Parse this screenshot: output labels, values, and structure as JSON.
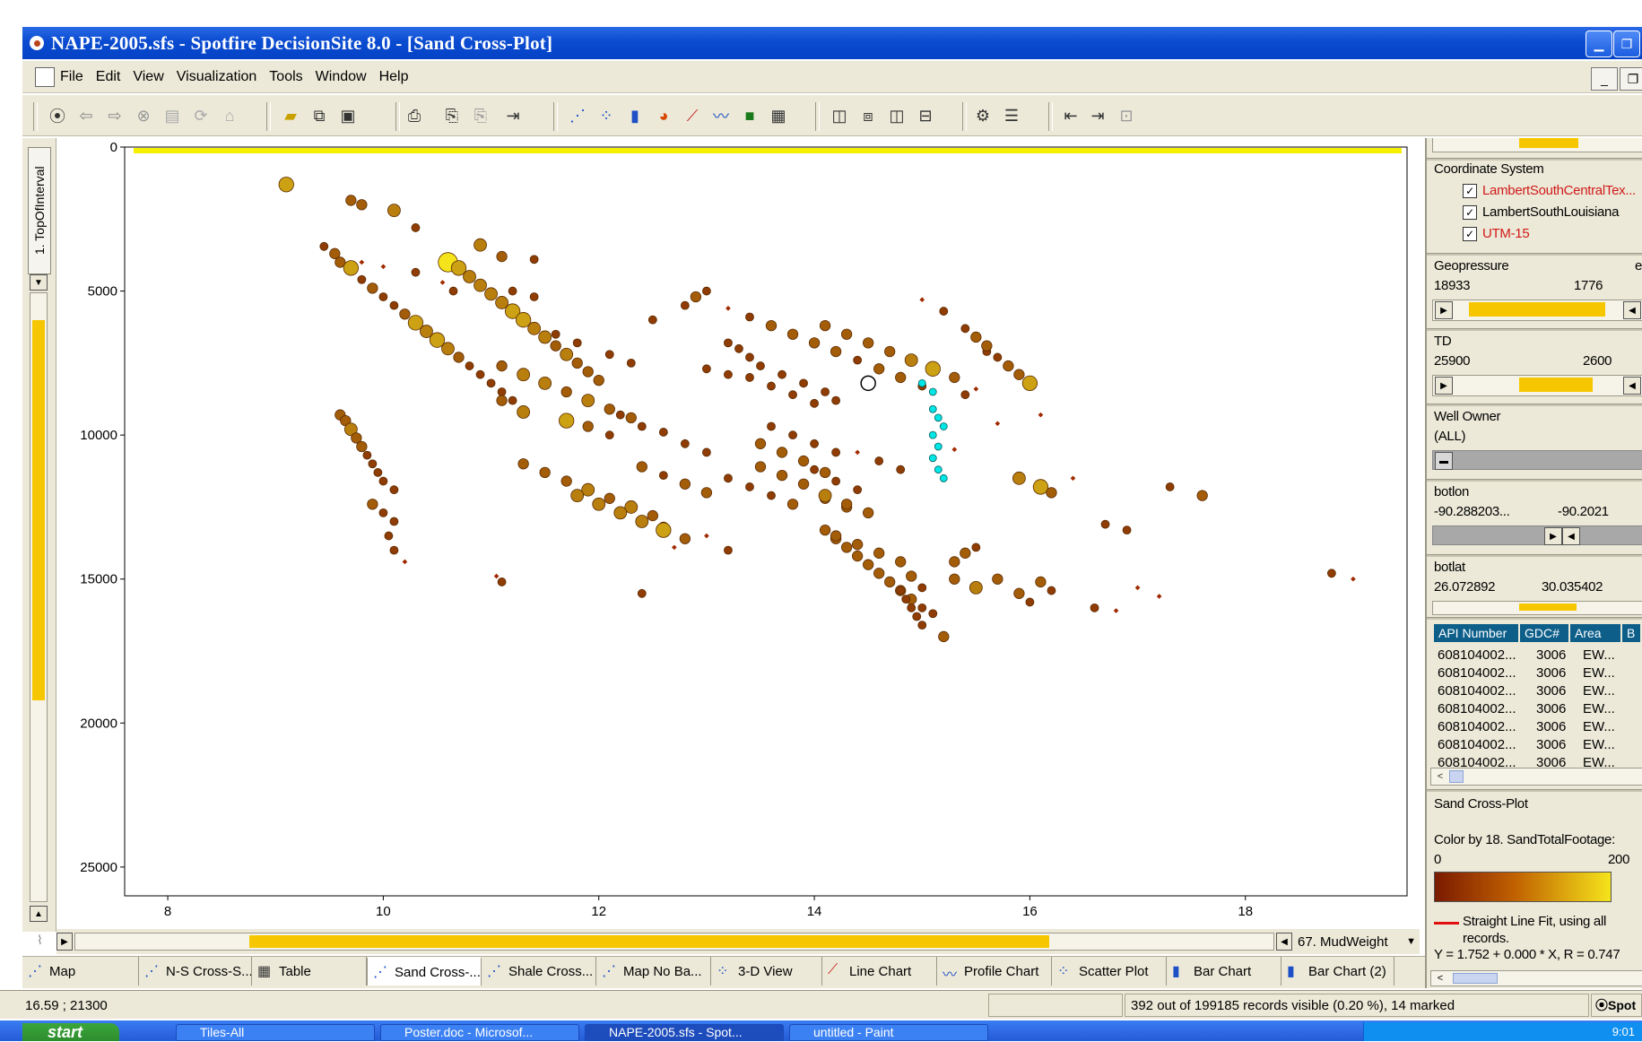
{
  "window": {
    "title": "NAPE-2005.sfs - Spotfire DecisionSite 8.0 - [Sand Cross-Plot]"
  },
  "menu": [
    "File",
    "Edit",
    "View",
    "Visualization",
    "Tools",
    "Window",
    "Help"
  ],
  "toolbar_icons": [
    "home-icon",
    "back-icon",
    "forward-icon",
    "stop-icon",
    "doc-icon",
    "refresh-icon",
    "house-icon",
    "open-icon",
    "copy-icon",
    "save-icon",
    "print-icon",
    "paste-icon",
    "paste2-icon",
    "export-icon",
    "scatter-icon",
    "scatter3d-icon",
    "bar-icon",
    "pie-icon",
    "line-icon",
    "profile-icon",
    "heatmap-icon",
    "table-icon",
    "layout1-icon",
    "layout2-icon",
    "layout3-icon",
    "layout4-icon",
    "properties-icon",
    "legend-icon",
    "prev-icon",
    "next-icon",
    "zoom-icon"
  ],
  "left_axis_label": "1. TopOfInterval",
  "x_axis_selector": "67. MudWeight",
  "chart_data": {
    "type": "scatter",
    "title": "",
    "xlabel": "",
    "ylabel": "",
    "xlim": [
      7.6,
      19.5
    ],
    "ylim": [
      0,
      26000
    ],
    "y_inverted": true,
    "x_ticks": [
      8,
      10,
      12,
      14,
      16,
      18
    ],
    "y_ticks": [
      0,
      5000,
      10000,
      15000,
      20000,
      25000
    ],
    "y_tick_labels": [
      "0",
      "5000",
      "10000",
      "15000",
      "20000",
      "25000"
    ],
    "color_scale": {
      "min": 0,
      "max": 200,
      "low_color": "#7a1a00",
      "high_color": "#f5e41c"
    },
    "reference_line": {
      "y": 0,
      "color": "#f7ef00"
    },
    "highlight_color": "#00e5e5",
    "points": [
      [
        9.1,
        1300,
        5
      ],
      [
        9.7,
        1850,
        3
      ],
      [
        9.8,
        2000,
        3
      ],
      [
        10.1,
        2200,
        4
      ],
      [
        10.3,
        2800,
        2
      ],
      [
        10.9,
        3400,
        4
      ],
      [
        11.1,
        3800,
        3
      ],
      [
        11.4,
        3900,
        2
      ],
      [
        9.45,
        3450,
        2
      ],
      [
        9.55,
        3700,
        3
      ],
      [
        9.6,
        4000,
        3
      ],
      [
        9.7,
        4200,
        5
      ],
      [
        9.8,
        4600,
        2
      ],
      [
        9.9,
        4900,
        3
      ],
      [
        10.0,
        5200,
        2
      ],
      [
        10.1,
        5500,
        2
      ],
      [
        10.2,
        5800,
        3
      ],
      [
        10.3,
        6100,
        5
      ],
      [
        10.4,
        6400,
        4
      ],
      [
        10.5,
        6700,
        5
      ],
      [
        10.6,
        7000,
        4
      ],
      [
        10.7,
        7300,
        3
      ],
      [
        10.8,
        7600,
        2
      ],
      [
        10.9,
        7900,
        2
      ],
      [
        11.0,
        8200,
        2
      ],
      [
        11.1,
        8500,
        2
      ],
      [
        11.2,
        8800,
        2
      ],
      [
        9.8,
        4000,
        1
      ],
      [
        10.0,
        4150,
        1
      ],
      [
        10.3,
        4350,
        2
      ],
      [
        10.55,
        4700,
        1
      ],
      [
        10.65,
        5000,
        2
      ],
      [
        10.6,
        4000,
        7
      ],
      [
        10.7,
        4200,
        5
      ],
      [
        10.8,
        4500,
        4
      ],
      [
        10.9,
        4800,
        4
      ],
      [
        11.0,
        5100,
        4
      ],
      [
        11.1,
        5400,
        4
      ],
      [
        11.2,
        5700,
        5
      ],
      [
        11.3,
        6000,
        5
      ],
      [
        11.4,
        6300,
        4
      ],
      [
        11.5,
        6600,
        4
      ],
      [
        11.6,
        6900,
        3
      ],
      [
        11.7,
        7200,
        4
      ],
      [
        11.8,
        7500,
        3
      ],
      [
        11.9,
        7800,
        3
      ],
      [
        12.0,
        8100,
        3
      ],
      [
        11.1,
        7600,
        3
      ],
      [
        11.3,
        7900,
        4
      ],
      [
        11.5,
        8200,
        4
      ],
      [
        11.7,
        8500,
        3
      ],
      [
        11.9,
        8800,
        4
      ],
      [
        12.1,
        9100,
        3
      ],
      [
        12.3,
        9400,
        3
      ],
      [
        11.2,
        5000,
        2
      ],
      [
        11.4,
        5200,
        2
      ],
      [
        11.6,
        6500,
        2
      ],
      [
        11.8,
        6800,
        2
      ],
      [
        12.1,
        7200,
        2
      ],
      [
        12.3,
        7500,
        2
      ],
      [
        11.1,
        8800,
        3
      ],
      [
        11.3,
        9200,
        4
      ],
      [
        11.7,
        9500,
        5
      ],
      [
        11.9,
        9700,
        3
      ],
      [
        12.1,
        10000,
        2
      ],
      [
        11.3,
        11000,
        3
      ],
      [
        11.5,
        11300,
        3
      ],
      [
        11.7,
        11600,
        3
      ],
      [
        11.9,
        11900,
        4
      ],
      [
        12.1,
        12200,
        3
      ],
      [
        12.3,
        12500,
        4
      ],
      [
        12.5,
        12800,
        3
      ],
      [
        12.6,
        13200,
        3
      ],
      [
        11.8,
        12100,
        4
      ],
      [
        12.0,
        12400,
        4
      ],
      [
        12.2,
        12700,
        4
      ],
      [
        12.4,
        13000,
        4
      ],
      [
        12.6,
        13300,
        5
      ],
      [
        12.8,
        13600,
        3
      ],
      [
        12.2,
        9300,
        2
      ],
      [
        12.4,
        9700,
        2
      ],
      [
        12.6,
        9900,
        2
      ],
      [
        12.8,
        10300,
        2
      ],
      [
        13.0,
        10600,
        2
      ],
      [
        12.4,
        11100,
        3
      ],
      [
        12.6,
        11400,
        2
      ],
      [
        12.8,
        11700,
        3
      ],
      [
        13.0,
        12000,
        3
      ],
      [
        9.6,
        9300,
        3
      ],
      [
        9.65,
        9500,
        3
      ],
      [
        9.7,
        9800,
        4
      ],
      [
        9.75,
        10100,
        3
      ],
      [
        9.8,
        10400,
        3
      ],
      [
        9.85,
        10700,
        2
      ],
      [
        9.9,
        11000,
        2
      ],
      [
        9.95,
        11300,
        2
      ],
      [
        10.0,
        11600,
        2
      ],
      [
        10.1,
        11900,
        2
      ],
      [
        9.9,
        12400,
        3
      ],
      [
        10.0,
        12700,
        2
      ],
      [
        10.1,
        13000,
        2
      ],
      [
        10.05,
        13500,
        2
      ],
      [
        10.1,
        14000,
        2
      ],
      [
        10.2,
        14400,
        1
      ],
      [
        11.05,
        14900,
        1
      ],
      [
        11.1,
        15100,
        2
      ],
      [
        12.4,
        15500,
        2
      ],
      [
        13.2,
        14000,
        2
      ],
      [
        12.7,
        13900,
        1
      ],
      [
        13.0,
        13500,
        1
      ],
      [
        12.5,
        6000,
        2
      ],
      [
        12.8,
        5500,
        2
      ],
      [
        12.9,
        5200,
        3
      ],
      [
        13.0,
        5000,
        2
      ],
      [
        13.2,
        6800,
        2
      ],
      [
        13.3,
        7000,
        2
      ],
      [
        13.4,
        7300,
        2
      ],
      [
        13.5,
        7600,
        2
      ],
      [
        13.7,
        7900,
        2
      ],
      [
        13.9,
        8200,
        2
      ],
      [
        14.1,
        8500,
        2
      ],
      [
        14.2,
        8800,
        2
      ],
      [
        13.0,
        7700,
        2
      ],
      [
        13.2,
        7900,
        2
      ],
      [
        13.4,
        8000,
        2
      ],
      [
        13.6,
        8300,
        2
      ],
      [
        13.8,
        8600,
        2
      ],
      [
        14.0,
        8900,
        2
      ],
      [
        13.2,
        5600,
        1
      ],
      [
        13.4,
        5900,
        2
      ],
      [
        13.6,
        6200,
        3
      ],
      [
        13.8,
        6500,
        3
      ],
      [
        14.0,
        6800,
        3
      ],
      [
        14.2,
        7100,
        3
      ],
      [
        14.4,
        7400,
        2
      ],
      [
        14.6,
        7700,
        3
      ],
      [
        14.8,
        8000,
        3
      ],
      [
        15.0,
        8300,
        2
      ],
      [
        14.1,
        6200,
        3
      ],
      [
        14.3,
        6500,
        3
      ],
      [
        14.5,
        6800,
        3
      ],
      [
        14.7,
        7100,
        3
      ],
      [
        14.9,
        7400,
        4
      ],
      [
        15.1,
        7700,
        5
      ],
      [
        15.3,
        8000,
        3
      ],
      [
        13.6,
        9700,
        2
      ],
      [
        13.8,
        10000,
        2
      ],
      [
        14.0,
        10300,
        2
      ],
      [
        14.2,
        10600,
        2
      ],
      [
        14.0,
        11200,
        2
      ],
      [
        14.2,
        11600,
        2
      ],
      [
        14.4,
        11900,
        2
      ],
      [
        14.1,
        12200,
        3
      ],
      [
        14.3,
        12500,
        3
      ],
      [
        13.5,
        10300,
        3
      ],
      [
        13.7,
        10600,
        3
      ],
      [
        13.9,
        10900,
        3
      ],
      [
        14.1,
        11300,
        3
      ],
      [
        13.2,
        11500,
        2
      ],
      [
        13.4,
        11800,
        2
      ],
      [
        13.6,
        12100,
        2
      ],
      [
        13.8,
        12400,
        3
      ],
      [
        13.5,
        11100,
        3
      ],
      [
        13.7,
        11400,
        3
      ],
      [
        13.9,
        11700,
        3
      ],
      [
        14.1,
        12100,
        4
      ],
      [
        14.3,
        12400,
        3
      ],
      [
        14.5,
        12700,
        3
      ],
      [
        14.1,
        13300,
        3
      ],
      [
        14.2,
        13600,
        3
      ],
      [
        14.3,
        13900,
        3
      ],
      [
        14.4,
        14200,
        3
      ],
      [
        14.5,
        14500,
        3
      ],
      [
        14.6,
        14800,
        3
      ],
      [
        14.7,
        15100,
        3
      ],
      [
        14.8,
        15400,
        3
      ],
      [
        14.9,
        15700,
        3
      ],
      [
        15.0,
        16000,
        2
      ],
      [
        14.2,
        13500,
        3
      ],
      [
        14.4,
        13800,
        3
      ],
      [
        14.6,
        14100,
        3
      ],
      [
        14.8,
        14400,
        3
      ],
      [
        14.9,
        14900,
        3
      ],
      [
        15.0,
        15300,
        2
      ],
      [
        15.1,
        16200,
        2
      ],
      [
        15.2,
        17000,
        3
      ],
      [
        14.8,
        15400,
        2
      ],
      [
        14.85,
        15700,
        2
      ],
      [
        14.9,
        16000,
        2
      ],
      [
        14.95,
        16300,
        2
      ],
      [
        15.0,
        16600,
        2
      ],
      [
        15.3,
        14400,
        3
      ],
      [
        15.4,
        14100,
        3
      ],
      [
        15.5,
        13900,
        2
      ],
      [
        15.3,
        15000,
        3
      ],
      [
        15.5,
        15300,
        4
      ],
      [
        15.7,
        15000,
        3
      ],
      [
        15.9,
        15500,
        3
      ],
      [
        16.0,
        15800,
        2
      ],
      [
        16.1,
        15100,
        3
      ],
      [
        16.2,
        15400,
        2
      ],
      [
        15.6,
        7100,
        2
      ],
      [
        15.7,
        7300,
        2
      ],
      [
        15.8,
        7600,
        3
      ],
      [
        15.9,
        7900,
        3
      ],
      [
        16.0,
        8200,
        5
      ],
      [
        15.5,
        8400,
        1
      ],
      [
        16.1,
        9300,
        1
      ],
      [
        16.4,
        11500,
        1
      ],
      [
        15.9,
        11500,
        4
      ],
      [
        16.1,
        11800,
        5
      ],
      [
        16.2,
        12000,
        3
      ],
      [
        16.7,
        13100,
        2
      ],
      [
        16.9,
        13300,
        2
      ],
      [
        16.6,
        16000,
        2
      ],
      [
        14.4,
        10600,
        1
      ],
      [
        14.6,
        10900,
        2
      ],
      [
        14.8,
        11200,
        2
      ],
      [
        15.3,
        10500,
        1
      ],
      [
        15.0,
        5300,
        1
      ],
      [
        15.2,
        5700,
        2
      ],
      [
        15.4,
        6300,
        2
      ],
      [
        15.5,
        6600,
        3
      ],
      [
        15.6,
        6900,
        3
      ],
      [
        15.4,
        8600,
        2
      ],
      [
        15.7,
        9600,
        1
      ],
      [
        17.3,
        11800,
        2
      ],
      [
        17.6,
        12100,
        3
      ],
      [
        17.0,
        15300,
        1
      ],
      [
        17.2,
        15600,
        1
      ],
      [
        16.8,
        16100,
        1
      ],
      [
        18.8,
        14800,
        2
      ],
      [
        19.0,
        15000,
        1
      ]
    ],
    "highlighted_points": [
      [
        15.0,
        8200
      ],
      [
        15.1,
        9100
      ],
      [
        15.15,
        9400
      ],
      [
        15.2,
        9700
      ],
      [
        15.1,
        10000
      ],
      [
        15.15,
        10400
      ],
      [
        15.1,
        10800
      ],
      [
        15.15,
        11200
      ],
      [
        15.2,
        11500
      ],
      [
        15.1,
        8500
      ]
    ],
    "marked_points": [
      [
        14.5,
        8200
      ]
    ]
  },
  "right_panel": {
    "coordinate_system_label": "Coordinate System",
    "coordinate_items": [
      {
        "label": "LambertSouthCentralTex...",
        "checked": "✓",
        "color": "#d11a1a"
      },
      {
        "label": "LambertSouthLouisiana",
        "checked": "✓",
        "color": "#000000"
      },
      {
        "label": "UTM-15",
        "checked": "✓",
        "color": "#d11a1a"
      }
    ],
    "geopressure": {
      "label": "Geopressure",
      "min": "18933",
      "max": "1776",
      "suffix": "e"
    },
    "td": {
      "label": "TD",
      "min": "25900",
      "max": "2600"
    },
    "well_owner": {
      "label": "Well Owner",
      "value": "(ALL)"
    },
    "botlon": {
      "label": "botlon",
      "min": "-90.288203...",
      "max": "-90.2021"
    },
    "botlat": {
      "label": "botlat",
      "min": "26.072892",
      "max": "30.035402"
    },
    "table_headers": [
      "API Number",
      "GDC#",
      "Area",
      "B"
    ],
    "table_rows": [
      [
        "608104002...",
        "3006",
        "EW..."
      ],
      [
        "608104002...",
        "3006",
        "EW..."
      ],
      [
        "608104002...",
        "3006",
        "EW..."
      ],
      [
        "608104002...",
        "3006",
        "EW..."
      ],
      [
        "608104002...",
        "3006",
        "EW..."
      ],
      [
        "608104002...",
        "3006",
        "EW..."
      ],
      [
        "608104002...",
        "3006",
        "EW..."
      ]
    ],
    "legend_title": "Sand Cross-Plot",
    "color_by": "Color by 18. SandTotalFootage:",
    "color_min": "0",
    "color_max": "200",
    "fit_line_label": "Straight Line Fit, using all records.",
    "fit_equation": "Y = 1.752 + 0.000 * X, R = 0.747"
  },
  "tabs": [
    "Map",
    "N-S Cross-S...",
    "Table",
    "Sand Cross-...",
    "Shale Cross...",
    "Map No Ba...",
    "3-D View",
    "Line Chart",
    "Profile Chart",
    "Scatter Plot",
    "Bar Chart",
    "Bar Chart (2)"
  ],
  "active_tab": "Sand Cross-...",
  "status": {
    "coords": "16.59 ; 21300",
    "records": "392 out of 199185 records visible (0.20 %), 14 marked",
    "brand": "Spot"
  },
  "taskbar": {
    "start": "start",
    "items": [
      "Tiles-All",
      "Poster.doc - Microsof...",
      "NAPE-2005.sfs - Spot...",
      "untitled - Paint"
    ],
    "clock": "9:01"
  },
  "colors": {
    "title_blue": "#0a4bd0",
    "panel_bg": "#ece9d8",
    "slider_yellow": "#f6c700",
    "table_header": "#0d5f8a"
  }
}
